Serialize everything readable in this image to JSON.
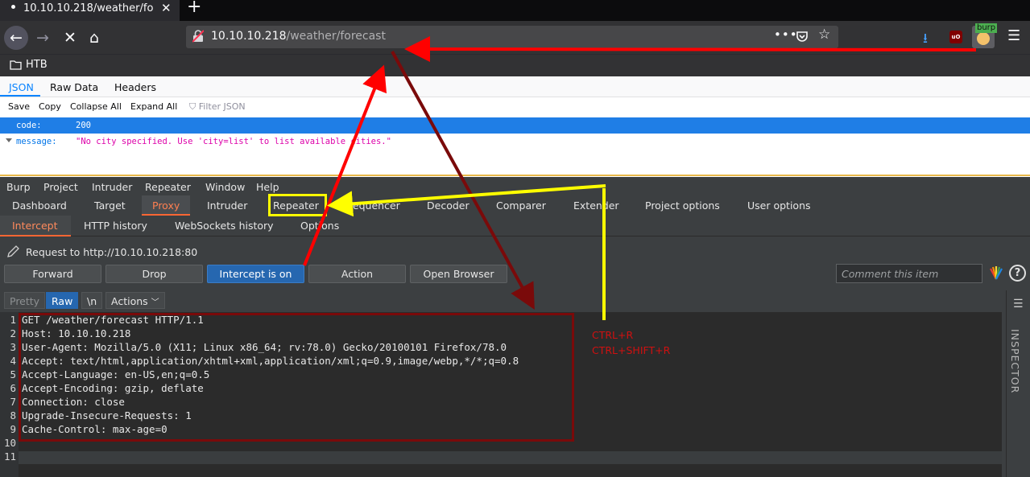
{
  "browser": {
    "tab_title": "10.10.10.218/weather/fo",
    "url_host": "10.10.10.218",
    "url_path": "/weather/forecast",
    "url_more": "•••",
    "extension_badge": "burp",
    "bookmark": "HTB"
  },
  "json_viewer": {
    "tabs": [
      "JSON",
      "Raw Data",
      "Headers"
    ],
    "toolbar": [
      "Save",
      "Copy",
      "Collapse All",
      "Expand All"
    ],
    "filter_placeholder": "Filter JSON",
    "rows": [
      {
        "key": "code:",
        "value": "200"
      },
      {
        "key": "message:",
        "value": "\"No city specified. Use 'city=list' to list available cities.\""
      }
    ]
  },
  "burp": {
    "menu": [
      "Burp",
      "Project",
      "Intruder",
      "Repeater",
      "Window",
      "Help"
    ],
    "tabs": [
      "Dashboard",
      "Target",
      "Proxy",
      "Intruder",
      "Repeater",
      "Sequencer",
      "Decoder",
      "Comparer",
      "Extender",
      "Project options",
      "User options"
    ],
    "subtabs": [
      "Intercept",
      "HTTP history",
      "WebSockets history",
      "Options"
    ],
    "request_to": "Request to http://10.10.10.218:80",
    "buttons": {
      "forward": "Forward",
      "drop": "Drop",
      "intercept": "Intercept is on",
      "action": "Action",
      "open_browser": "Open Browser"
    },
    "comment_placeholder": "Comment this item",
    "help": "?",
    "editor_tabs": {
      "pretty": "Pretty",
      "raw": "Raw",
      "newline": "\\n",
      "actions": "Actions"
    },
    "inspector": "INSPECTOR",
    "request_lines": [
      {
        "n": "1",
        "text": "GET /weather/forecast HTTP/1.1"
      },
      {
        "n": "2",
        "text": "Host: 10.10.10.218"
      },
      {
        "n": "3",
        "text": "User-Agent: Mozilla/5.0 (X11; Linux x86_64; rv:78.0) Gecko/20100101 Firefox/78.0"
      },
      {
        "n": "4",
        "text": "Accept: text/html,application/xhtml+xml,application/xml;q=0.9,image/webp,*/*;q=0.8"
      },
      {
        "n": "5",
        "text": "Accept-Language: en-US,en;q=0.5"
      },
      {
        "n": "6",
        "text": "Accept-Encoding: gzip, deflate"
      },
      {
        "n": "7",
        "text": "Connection: close"
      },
      {
        "n": "8",
        "text": "Upgrade-Insecure-Requests: 1"
      },
      {
        "n": "9",
        "text": "Cache-Control: max-age=0"
      },
      {
        "n": "10",
        "text": ""
      },
      {
        "n": "11",
        "text": ""
      }
    ]
  },
  "annotations": {
    "shortcut_1": "CTRL+R",
    "shortcut_2": "CTRL+SHIFT+R",
    "colors": {
      "red": "#ff0000",
      "dark_red": "#7a0a0a",
      "yellow": "#ffff00"
    }
  }
}
